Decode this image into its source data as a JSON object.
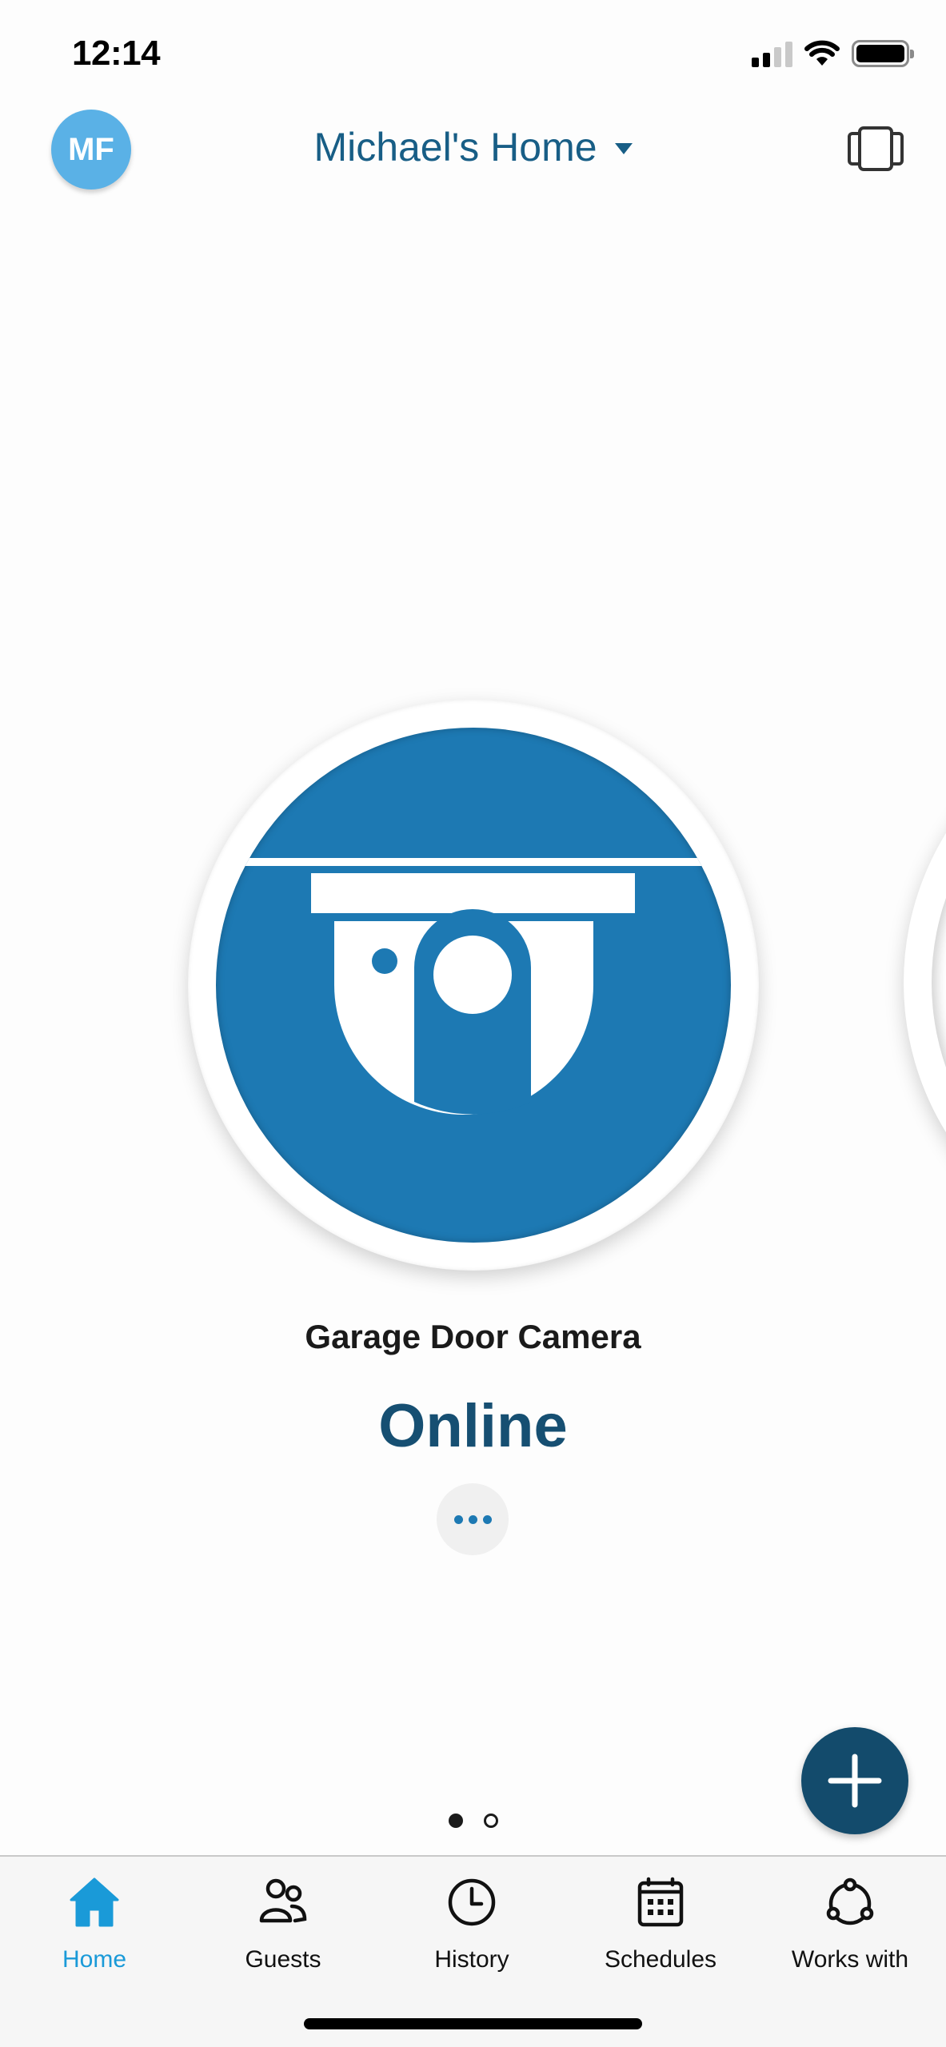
{
  "status_bar": {
    "time": "12:14",
    "signal_bars_active": 2,
    "signal_bars_total": 4,
    "icons": [
      "signal-icon",
      "wifi-icon",
      "battery-icon"
    ]
  },
  "header": {
    "avatar_initials": "MF",
    "home_name": "Michael's Home",
    "home_dropdown_icon": "caret-down-icon",
    "right_icon": "device-carousel-icon"
  },
  "device": {
    "name": "Garage Door Camera",
    "status": "Online",
    "icon": "dome-camera-icon",
    "more_icon": "ellipsis-icon"
  },
  "pager": {
    "current": 1,
    "total": 2
  },
  "fab": {
    "icon": "plus-icon"
  },
  "tabs": [
    {
      "label": "Home",
      "icon": "home-icon",
      "active": true
    },
    {
      "label": "Guests",
      "icon": "guests-icon",
      "active": false
    },
    {
      "label": "History",
      "icon": "clock-icon",
      "active": false
    },
    {
      "label": "Schedules",
      "icon": "calendar-icon",
      "active": false
    },
    {
      "label": "Works with",
      "icon": "integrations-icon",
      "active": false
    }
  ],
  "colors": {
    "accent": "#1a9ad8",
    "brand_dark": "#134b6c",
    "device_blue": "#1d79b3",
    "title_blue": "#185e86",
    "avatar_blue": "#5ab1e6"
  }
}
